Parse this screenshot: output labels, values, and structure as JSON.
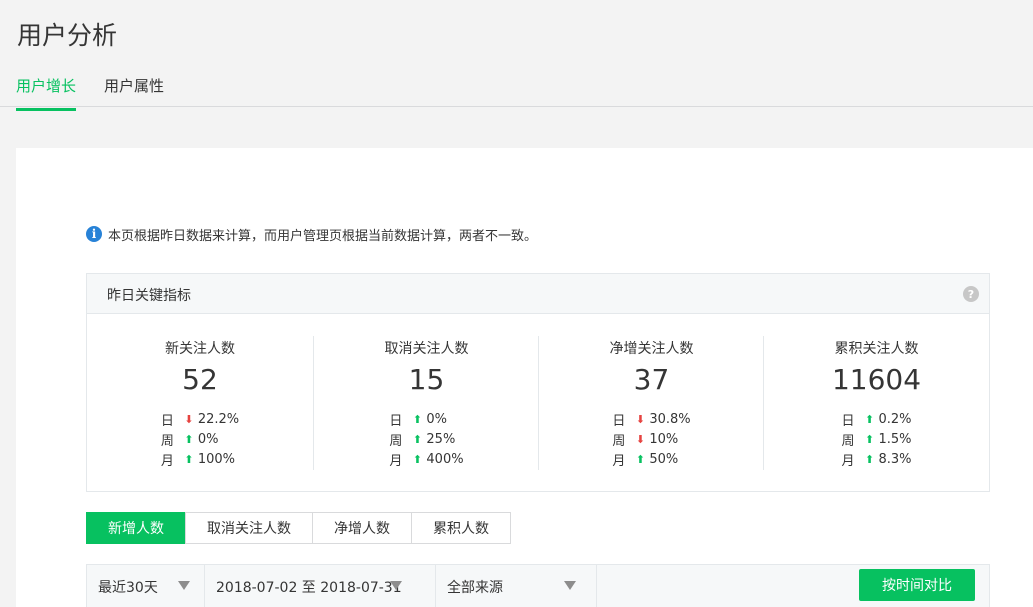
{
  "page": {
    "title": "用户分析"
  },
  "tabs": [
    {
      "label": "用户增长",
      "active": true
    },
    {
      "label": "用户属性",
      "active": false
    }
  ],
  "notice": {
    "icon": "info-icon",
    "text": "本页根据昨日数据来计算，而用户管理页根据当前数据计算，两者不一致。"
  },
  "kpi": {
    "title": "昨日关键指标",
    "help_icon": "?",
    "items": [
      {
        "label": "新关注人数",
        "value": "52",
        "trends": [
          {
            "period": "日",
            "dir": "down",
            "pct": "22.2%"
          },
          {
            "period": "周",
            "dir": "up",
            "pct": "0%"
          },
          {
            "period": "月",
            "dir": "up",
            "pct": "100%"
          }
        ]
      },
      {
        "label": "取消关注人数",
        "value": "15",
        "trends": [
          {
            "period": "日",
            "dir": "up",
            "pct": "0%"
          },
          {
            "period": "周",
            "dir": "up",
            "pct": "25%"
          },
          {
            "period": "月",
            "dir": "up",
            "pct": "400%"
          }
        ]
      },
      {
        "label": "净增关注人数",
        "value": "37",
        "trends": [
          {
            "period": "日",
            "dir": "down",
            "pct": "30.8%"
          },
          {
            "period": "周",
            "dir": "down",
            "pct": "10%"
          },
          {
            "period": "月",
            "dir": "up",
            "pct": "50%"
          }
        ]
      },
      {
        "label": "累积关注人数",
        "value": "11604",
        "trends": [
          {
            "period": "日",
            "dir": "up",
            "pct": "0.2%"
          },
          {
            "period": "周",
            "dir": "up",
            "pct": "1.5%"
          },
          {
            "period": "月",
            "dir": "up",
            "pct": "8.3%"
          }
        ]
      }
    ]
  },
  "segments": [
    {
      "label": "新增人数",
      "active": true
    },
    {
      "label": "取消关注人数",
      "active": false
    },
    {
      "label": "净增人数",
      "active": false
    },
    {
      "label": "累积人数",
      "active": false
    }
  ],
  "filters": {
    "range": "最近30天",
    "dates": "2018-07-02 至 2018-07-31",
    "source": "全部来源",
    "compare_label": "按时间对比"
  },
  "colors": {
    "accent": "#07c160",
    "up": "#07c160",
    "down": "#e64340",
    "info": "#2782d7"
  }
}
